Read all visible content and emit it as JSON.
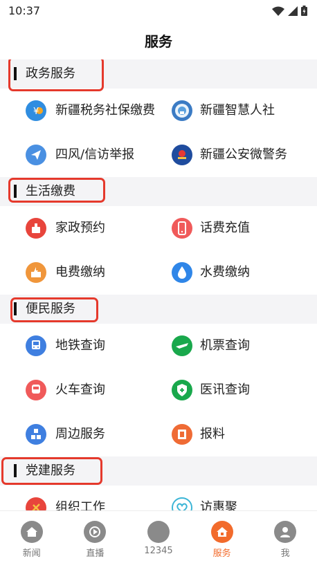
{
  "status_bar": {
    "time": "10:37"
  },
  "header": {
    "title": "服务"
  },
  "sections": [
    {
      "title": "政务服务",
      "items": [
        {
          "label": "新疆税务社保缴费",
          "icon": "tax-icon"
        },
        {
          "label": "新疆智慧人社",
          "icon": "social-security-icon"
        },
        {
          "label": "四风/信访举报",
          "icon": "paper-plane-icon"
        },
        {
          "label": "新疆公安微警务",
          "icon": "police-badge-icon"
        }
      ]
    },
    {
      "title": "生活缴费",
      "items": [
        {
          "label": "家政预约",
          "icon": "housekeeping-icon"
        },
        {
          "label": "话费充值",
          "icon": "phone-icon"
        },
        {
          "label": "电费缴纳",
          "icon": "electricity-icon"
        },
        {
          "label": "水费缴纳",
          "icon": "water-drop-icon"
        }
      ]
    },
    {
      "title": "便民服务",
      "items": [
        {
          "label": "地铁查询",
          "icon": "subway-icon"
        },
        {
          "label": "机票查询",
          "icon": "airplane-icon"
        },
        {
          "label": "火车查询",
          "icon": "train-icon"
        },
        {
          "label": "医讯查询",
          "icon": "medical-shield-icon"
        },
        {
          "label": "周边服务",
          "icon": "nearby-blocks-icon"
        },
        {
          "label": "报料",
          "icon": "report-icon"
        }
      ]
    },
    {
      "title": "党建服务",
      "items": [
        {
          "label": "组织工作",
          "icon": "party-emblem-icon"
        },
        {
          "label": "访惠聚",
          "icon": "heart-hands-icon"
        }
      ]
    }
  ],
  "tabbar": [
    {
      "label": "新闻",
      "icon": "home-icon",
      "active": false
    },
    {
      "label": "直播",
      "icon": "live-icon",
      "active": false
    },
    {
      "label": "12345",
      "icon": "hotline-icon",
      "active": false
    },
    {
      "label": "服务",
      "icon": "service-icon",
      "active": true
    },
    {
      "label": "我",
      "icon": "user-icon",
      "active": false
    }
  ],
  "colors": {
    "accent": "#f26b2c",
    "highlight_box": "#e5392c",
    "section_bg": "#f4f4f6"
  }
}
